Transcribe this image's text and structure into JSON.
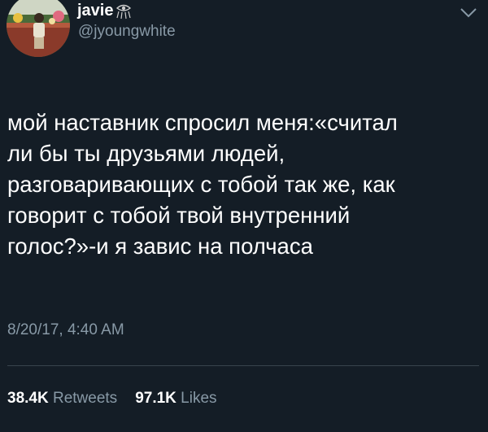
{
  "author": {
    "display_name": "javie",
    "name_emoji": "eye-of-providence-icon",
    "handle": "@jyoungwhite"
  },
  "tweet": {
    "lines": [
      "мой наставник спросил меня:«считал",
      "ли бы ты друзьями людей,",
      "разговаривающих с тобой так же, как",
      "говорит с тобой твой внутренний",
      "голос?»-и я завис на полчаса"
    ],
    "timestamp": "8/20/17, 4:40 AM"
  },
  "stats": {
    "retweets_count": "38.4K",
    "retweets_label": "Retweets",
    "likes_count": "97.1K",
    "likes_label": "Likes"
  },
  "colors": {
    "background": "#141d26",
    "secondary_text": "#8899a6",
    "divider": "#38444d"
  }
}
